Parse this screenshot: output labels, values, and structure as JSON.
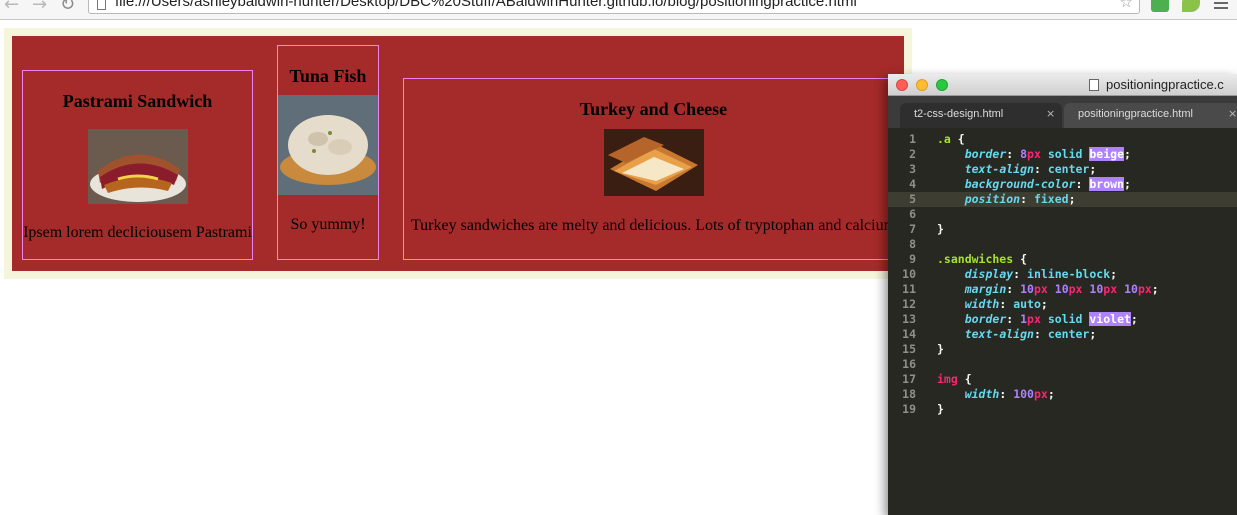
{
  "browser": {
    "url": "file:///Users/ashleybaldwin-hunter/Desktop/DBC%20Stuff/ABaldwinHunter.github.io/blog/positioningpractice.html"
  },
  "sandwiches": [
    {
      "title": "Pastrami Sandwich",
      "image": "pastrami-sandwich-photo",
      "caption": "Ipsem lorem decliciousem Pastrami"
    },
    {
      "title": "Tuna Fish",
      "image": "tuna-fish-photo",
      "caption": "So yummy!"
    },
    {
      "title": "Turkey and Cheese",
      "image": "turkey-and-cheese-photo",
      "caption": "Turkey sandwiches are melty and delicious. Lots of tryptophan and calcium"
    }
  ],
  "editor": {
    "window_title": "positioningpractice.c",
    "tabs": [
      {
        "label": "t2-css-design.html",
        "close": "×"
      },
      {
        "label": "positioningpractice.html",
        "close": "×"
      }
    ],
    "line_numbers": [
      "1",
      "2",
      "3",
      "4",
      "5",
      "6",
      "7",
      "8",
      "9",
      "10",
      "11",
      "12",
      "13",
      "14",
      "15",
      "16",
      "17",
      "18",
      "19"
    ],
    "active_line": "5",
    "code_lines": [
      [
        {
          "t": ".a",
          "c": "sel"
        },
        {
          "t": " {",
          "c": ""
        }
      ],
      [
        {
          "t": "    ",
          "c": ""
        },
        {
          "t": "border",
          "c": "prop"
        },
        {
          "t": ": ",
          "c": ""
        },
        {
          "t": "8",
          "c": "num"
        },
        {
          "t": "px",
          "c": "unit"
        },
        {
          "t": " solid ",
          "c": "val"
        },
        {
          "t": "beige",
          "c": "hl"
        },
        {
          "t": ";",
          "c": ""
        }
      ],
      [
        {
          "t": "    ",
          "c": ""
        },
        {
          "t": "text-align",
          "c": "prop"
        },
        {
          "t": ": ",
          "c": ""
        },
        {
          "t": "center",
          "c": "val"
        },
        {
          "t": ";",
          "c": ""
        }
      ],
      [
        {
          "t": "    ",
          "c": ""
        },
        {
          "t": "background-color",
          "c": "prop"
        },
        {
          "t": ": ",
          "c": ""
        },
        {
          "t": "brown",
          "c": "hl"
        },
        {
          "t": ";",
          "c": ""
        }
      ],
      [
        {
          "t": "    ",
          "c": ""
        },
        {
          "t": "position",
          "c": "prop"
        },
        {
          "t": ": ",
          "c": ""
        },
        {
          "t": "fixed",
          "c": "val"
        },
        {
          "t": ";",
          "c": ""
        }
      ],
      [],
      [
        {
          "t": "}",
          "c": ""
        }
      ],
      [],
      [
        {
          "t": ".sandwiches",
          "c": "sel"
        },
        {
          "t": " {",
          "c": ""
        }
      ],
      [
        {
          "t": "    ",
          "c": ""
        },
        {
          "t": "display",
          "c": "prop"
        },
        {
          "t": ": ",
          "c": ""
        },
        {
          "t": "inline-block",
          "c": "val"
        },
        {
          "t": ";",
          "c": ""
        }
      ],
      [
        {
          "t": "    ",
          "c": ""
        },
        {
          "t": "margin",
          "c": "prop"
        },
        {
          "t": ": ",
          "c": ""
        },
        {
          "t": "10",
          "c": "num"
        },
        {
          "t": "px",
          "c": "unit"
        },
        {
          "t": " ",
          "c": ""
        },
        {
          "t": "10",
          "c": "num"
        },
        {
          "t": "px",
          "c": "unit"
        },
        {
          "t": " ",
          "c": ""
        },
        {
          "t": "10",
          "c": "num"
        },
        {
          "t": "px",
          "c": "unit"
        },
        {
          "t": " ",
          "c": ""
        },
        {
          "t": "10",
          "c": "num"
        },
        {
          "t": "px",
          "c": "unit"
        },
        {
          "t": ";",
          "c": ""
        }
      ],
      [
        {
          "t": "    ",
          "c": ""
        },
        {
          "t": "width",
          "c": "prop"
        },
        {
          "t": ": ",
          "c": ""
        },
        {
          "t": "auto",
          "c": "val"
        },
        {
          "t": ";",
          "c": ""
        }
      ],
      [
        {
          "t": "    ",
          "c": ""
        },
        {
          "t": "border",
          "c": "prop"
        },
        {
          "t": ": ",
          "c": ""
        },
        {
          "t": "1",
          "c": "num"
        },
        {
          "t": "px",
          "c": "unit"
        },
        {
          "t": " solid ",
          "c": "val"
        },
        {
          "t": "violet",
          "c": "hl"
        },
        {
          "t": ";",
          "c": ""
        }
      ],
      [
        {
          "t": "    ",
          "c": ""
        },
        {
          "t": "text-align",
          "c": "prop"
        },
        {
          "t": ": ",
          "c": ""
        },
        {
          "t": "center",
          "c": "val"
        },
        {
          "t": ";",
          "c": ""
        }
      ],
      [
        {
          "t": "}",
          "c": ""
        }
      ],
      [],
      [
        {
          "t": "img",
          "c": "tag"
        },
        {
          "t": " {",
          "c": ""
        }
      ],
      [
        {
          "t": "    ",
          "c": ""
        },
        {
          "t": "width",
          "c": "prop"
        },
        {
          "t": ": ",
          "c": ""
        },
        {
          "t": "100",
          "c": "num"
        },
        {
          "t": "px",
          "c": "unit"
        },
        {
          "t": ";",
          "c": ""
        }
      ],
      [
        {
          "t": "}",
          "c": ""
        }
      ]
    ]
  }
}
